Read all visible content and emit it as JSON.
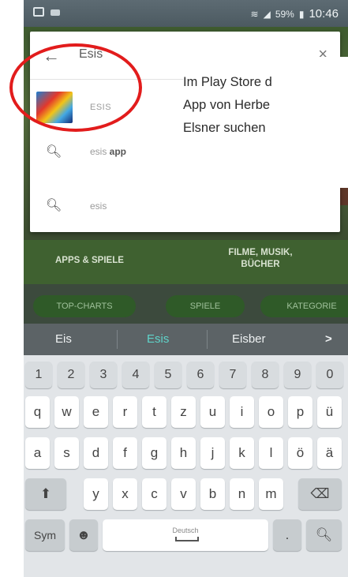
{
  "statusbar": {
    "time": "10:46",
    "battery": "59%"
  },
  "search": {
    "query": "Esis",
    "back_icon": "arrow-left-icon",
    "clear_icon": "close-icon"
  },
  "results": {
    "app_name": "ESIS",
    "suggestions": [
      {
        "prefix": "esis",
        "bold": " app"
      },
      {
        "prefix": "esis",
        "bold": ""
      }
    ]
  },
  "tabs": {
    "apps": "APPS & SPIELE",
    "films_1": "FILME, MUSIK,",
    "films_2": "BÜCHER"
  },
  "chips": [
    "TOP-CHARTS",
    "SPIELE",
    "KATEGORIE"
  ],
  "predictions": [
    "Eis",
    "Esis",
    "Eisber",
    ">"
  ],
  "keyboard": {
    "numbers": [
      "1",
      "2",
      "3",
      "4",
      "5",
      "6",
      "7",
      "8",
      "9",
      "0"
    ],
    "row1": [
      "q",
      "w",
      "e",
      "r",
      "t",
      "z",
      "u",
      "i",
      "o",
      "p",
      "ü"
    ],
    "row2": [
      "a",
      "s",
      "d",
      "f",
      "g",
      "h",
      "j",
      "k",
      "l",
      "ö",
      "ä"
    ],
    "row3": [
      "y",
      "x",
      "c",
      "v",
      "b",
      "n",
      "m"
    ],
    "sym": "Sym",
    "space": "Deutsch"
  },
  "annotation": [
    "Im Play Store d",
    "App von Herbe",
    "Elsner suchen"
  ]
}
